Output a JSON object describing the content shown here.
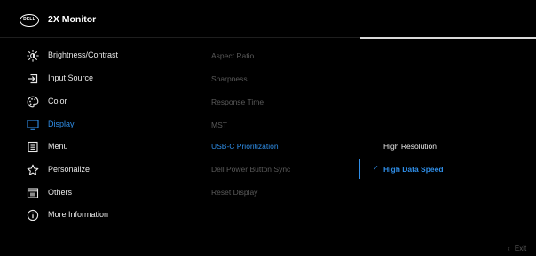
{
  "header": {
    "logo_text": "DELL",
    "title": "2X Monitor"
  },
  "main_menu": [
    {
      "label": "Brightness/Contrast",
      "icon": "brightness-icon",
      "active": false
    },
    {
      "label": "Input Source",
      "icon": "input-source-icon",
      "active": false
    },
    {
      "label": "Color",
      "icon": "color-palette-icon",
      "active": false
    },
    {
      "label": "Display",
      "icon": "display-icon",
      "active": true
    },
    {
      "label": "Menu",
      "icon": "menu-icon",
      "active": false
    },
    {
      "label": "Personalize",
      "icon": "star-icon",
      "active": false
    },
    {
      "label": "Others",
      "icon": "others-icon",
      "active": false
    },
    {
      "label": "More Information",
      "icon": "info-icon",
      "active": false
    }
  ],
  "submenu": [
    {
      "label": "Aspect Ratio",
      "active": false
    },
    {
      "label": "Sharpness",
      "active": false
    },
    {
      "label": "Response Time",
      "active": false
    },
    {
      "label": "MST",
      "active": false
    },
    {
      "label": "USB-C Prioritization",
      "active": true
    },
    {
      "label": "Dell Power Button Sync",
      "active": false
    },
    {
      "label": "Reset Display",
      "active": false
    }
  ],
  "options": [
    {
      "label": "High Resolution",
      "selected": false
    },
    {
      "label": "High Data Speed",
      "selected": true
    }
  ],
  "footer": {
    "exit_label": "Exit",
    "exit_icon": "chevron-left-icon"
  },
  "colors": {
    "accent": "#2f8ee8",
    "background": "#000000",
    "inactive_text": "#5a5a5a"
  }
}
